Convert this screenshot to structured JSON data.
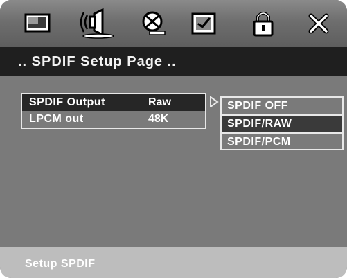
{
  "toolbar": {
    "icons": [
      {
        "name": "general-setup-icon"
      },
      {
        "name": "audio-setup-icon"
      },
      {
        "name": "dolby-digital-icon"
      },
      {
        "name": "preference-icon"
      },
      {
        "name": "lock-icon"
      },
      {
        "name": "exit-icon"
      }
    ]
  },
  "title": ".. SPDIF Setup Page ..",
  "menu": {
    "items": [
      {
        "label": "SPDIF Output",
        "value": "Raw",
        "selected": true
      },
      {
        "label": "LPCM out",
        "value": "48K",
        "selected": false
      }
    ]
  },
  "options": {
    "items": [
      {
        "label": "SPDIF OFF",
        "highlighted": false
      },
      {
        "label": "SPDIF/RAW",
        "highlighted": true
      },
      {
        "label": "SPDIF/PCM",
        "highlighted": false
      }
    ]
  },
  "status": "Setup SPDIF",
  "colors": {
    "panel": "#555555",
    "title_bar": "#1f1f1f",
    "main_area": "#7a7a7a",
    "bottom_bar": "#bdbdbd",
    "highlight": "#262626"
  }
}
